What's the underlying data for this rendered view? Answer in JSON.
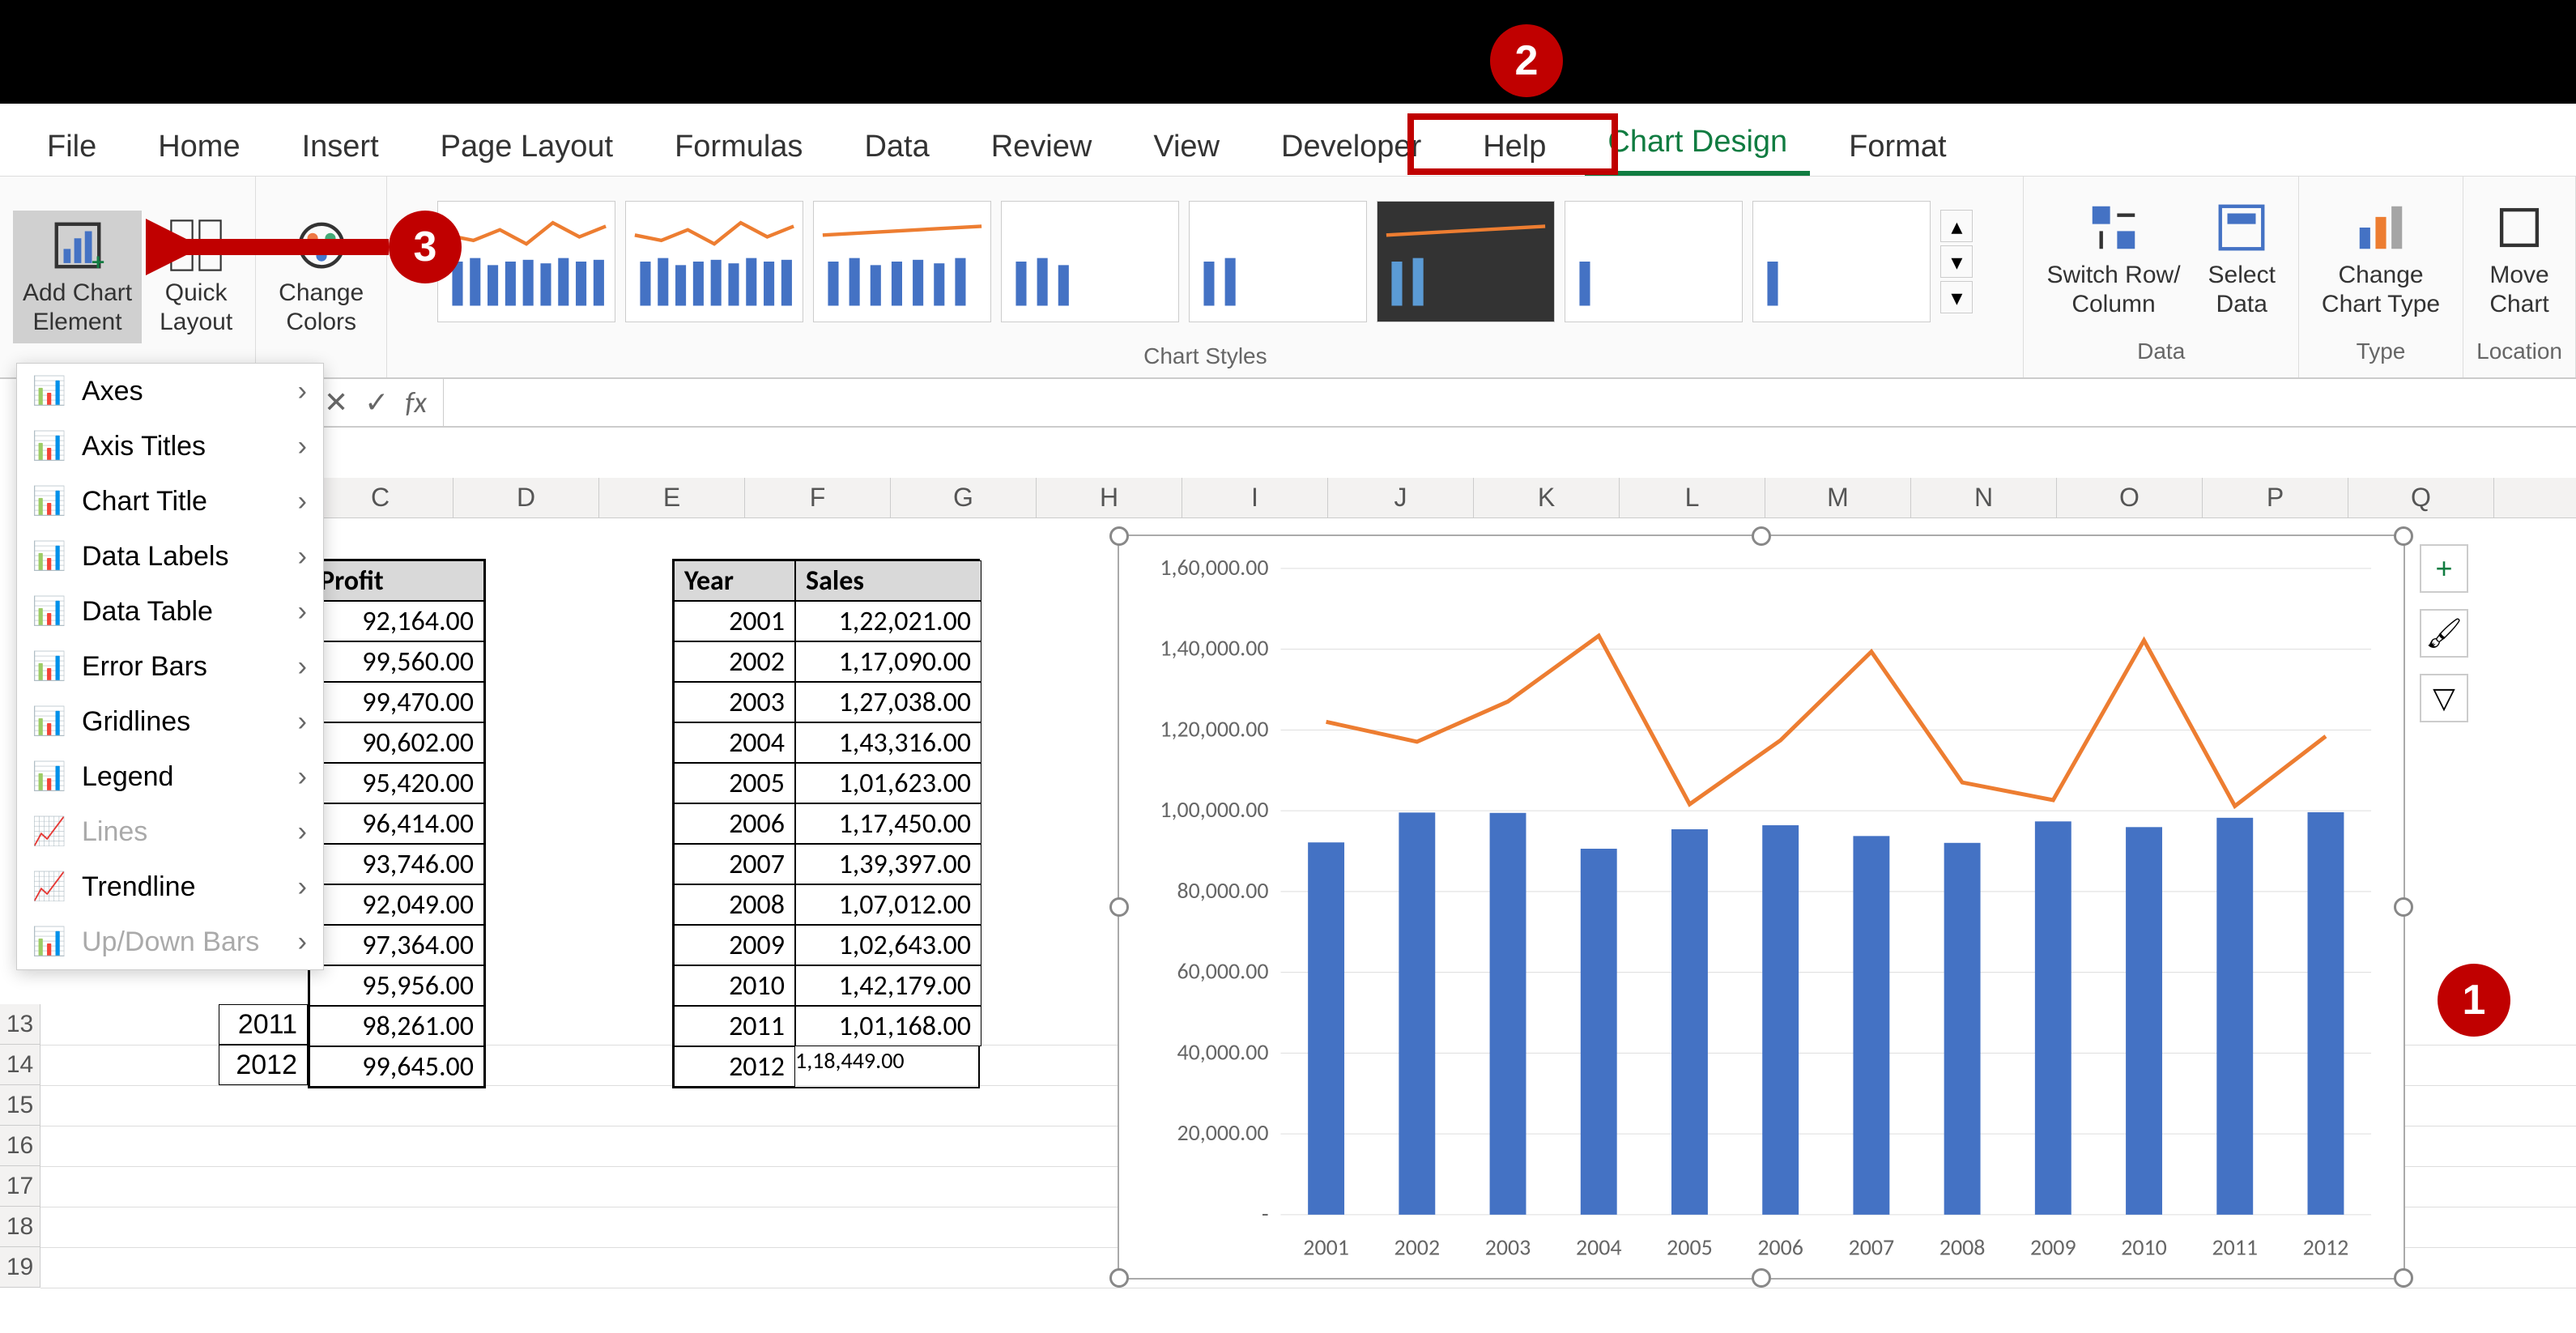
{
  "tabs": [
    "File",
    "Home",
    "Insert",
    "Page Layout",
    "Formulas",
    "Data",
    "Review",
    "View",
    "Developer",
    "Help",
    "Chart Design",
    "Format"
  ],
  "active_tab": "Chart Design",
  "ribbon": {
    "add_chart_element": "Add Chart\nElement",
    "quick_layout": "Quick\nLayout",
    "change_colors": "Change\nColors",
    "chart_styles_caption": "Chart Styles",
    "switch_rowcol": "Switch Row/\nColumn",
    "select_data": "Select\nData",
    "data_caption": "Data",
    "change_chart_type": "Change\nChart Type",
    "type_caption": "Type",
    "move_chart": "Move\nChart",
    "location_caption": "Location"
  },
  "menu": {
    "axes": "Axes",
    "axis_titles": "Axis Titles",
    "chart_title": "Chart Title",
    "data_labels": "Data Labels",
    "data_table": "Data Table",
    "error_bars": "Error Bars",
    "gridlines": "Gridlines",
    "legend": "Legend",
    "lines": "Lines",
    "trendline": "Trendline",
    "updown": "Up/Down Bars"
  },
  "formula_bar": {
    "fx": "fx"
  },
  "col_letters": [
    "C",
    "D",
    "E",
    "F",
    "G",
    "H",
    "I",
    "J",
    "K",
    "L",
    "M",
    "N",
    "O",
    "P",
    "Q"
  ],
  "row_numbers": [
    "13",
    "14",
    "15",
    "16",
    "17",
    "18",
    "19"
  ],
  "table1": {
    "header": "Profit",
    "rows": [
      "92,164.00",
      "99,560.00",
      "99,470.00",
      "90,602.00",
      "95,420.00",
      "96,414.00",
      "93,746.00",
      "92,049.00",
      "97,364.00",
      "95,956.00",
      "98,261.00",
      "99,645.00"
    ],
    "years_tail": [
      "2011",
      "2012"
    ]
  },
  "table2": {
    "h1": "Year",
    "h2": "Sales",
    "rows": [
      [
        "2001",
        "1,22,021.00"
      ],
      [
        "2002",
        "1,17,090.00"
      ],
      [
        "2003",
        "1,27,038.00"
      ],
      [
        "2004",
        "1,43,316.00"
      ],
      [
        "2005",
        "1,01,623.00"
      ],
      [
        "2006",
        "1,17,450.00"
      ],
      [
        "2007",
        "1,39,397.00"
      ],
      [
        "2008",
        "1,07,012.00"
      ],
      [
        "2009",
        "1,02,643.00"
      ],
      [
        "2010",
        "1,42,179.00"
      ],
      [
        "2011",
        "1,01,168.00"
      ],
      [
        "2012",
        "1,18,449.00"
      ]
    ]
  },
  "chart_data": {
    "type": "bar",
    "categories": [
      "2001",
      "2002",
      "2003",
      "2004",
      "2005",
      "2006",
      "2007",
      "2008",
      "2009",
      "2010",
      "2011",
      "2012"
    ],
    "series": [
      {
        "name": "Profit",
        "type": "bar",
        "values": [
          92164,
          99560,
          99470,
          90602,
          95420,
          96414,
          93746,
          92049,
          97364,
          95956,
          98261,
          99645
        ]
      },
      {
        "name": "Sales",
        "type": "line",
        "values": [
          122021,
          117090,
          127038,
          143316,
          101623,
          117450,
          139397,
          107012,
          102643,
          142179,
          101168,
          118449
        ]
      }
    ],
    "yticks": [
      "-",
      "20,000.00",
      "40,000.00",
      "60,000.00",
      "80,000.00",
      "1,00,000.00",
      "1,20,000.00",
      "1,40,000.00",
      "1,60,000.00"
    ],
    "ylim": [
      0,
      160000
    ]
  },
  "callouts": {
    "c1": "1",
    "c2": "2",
    "c3": "3"
  }
}
